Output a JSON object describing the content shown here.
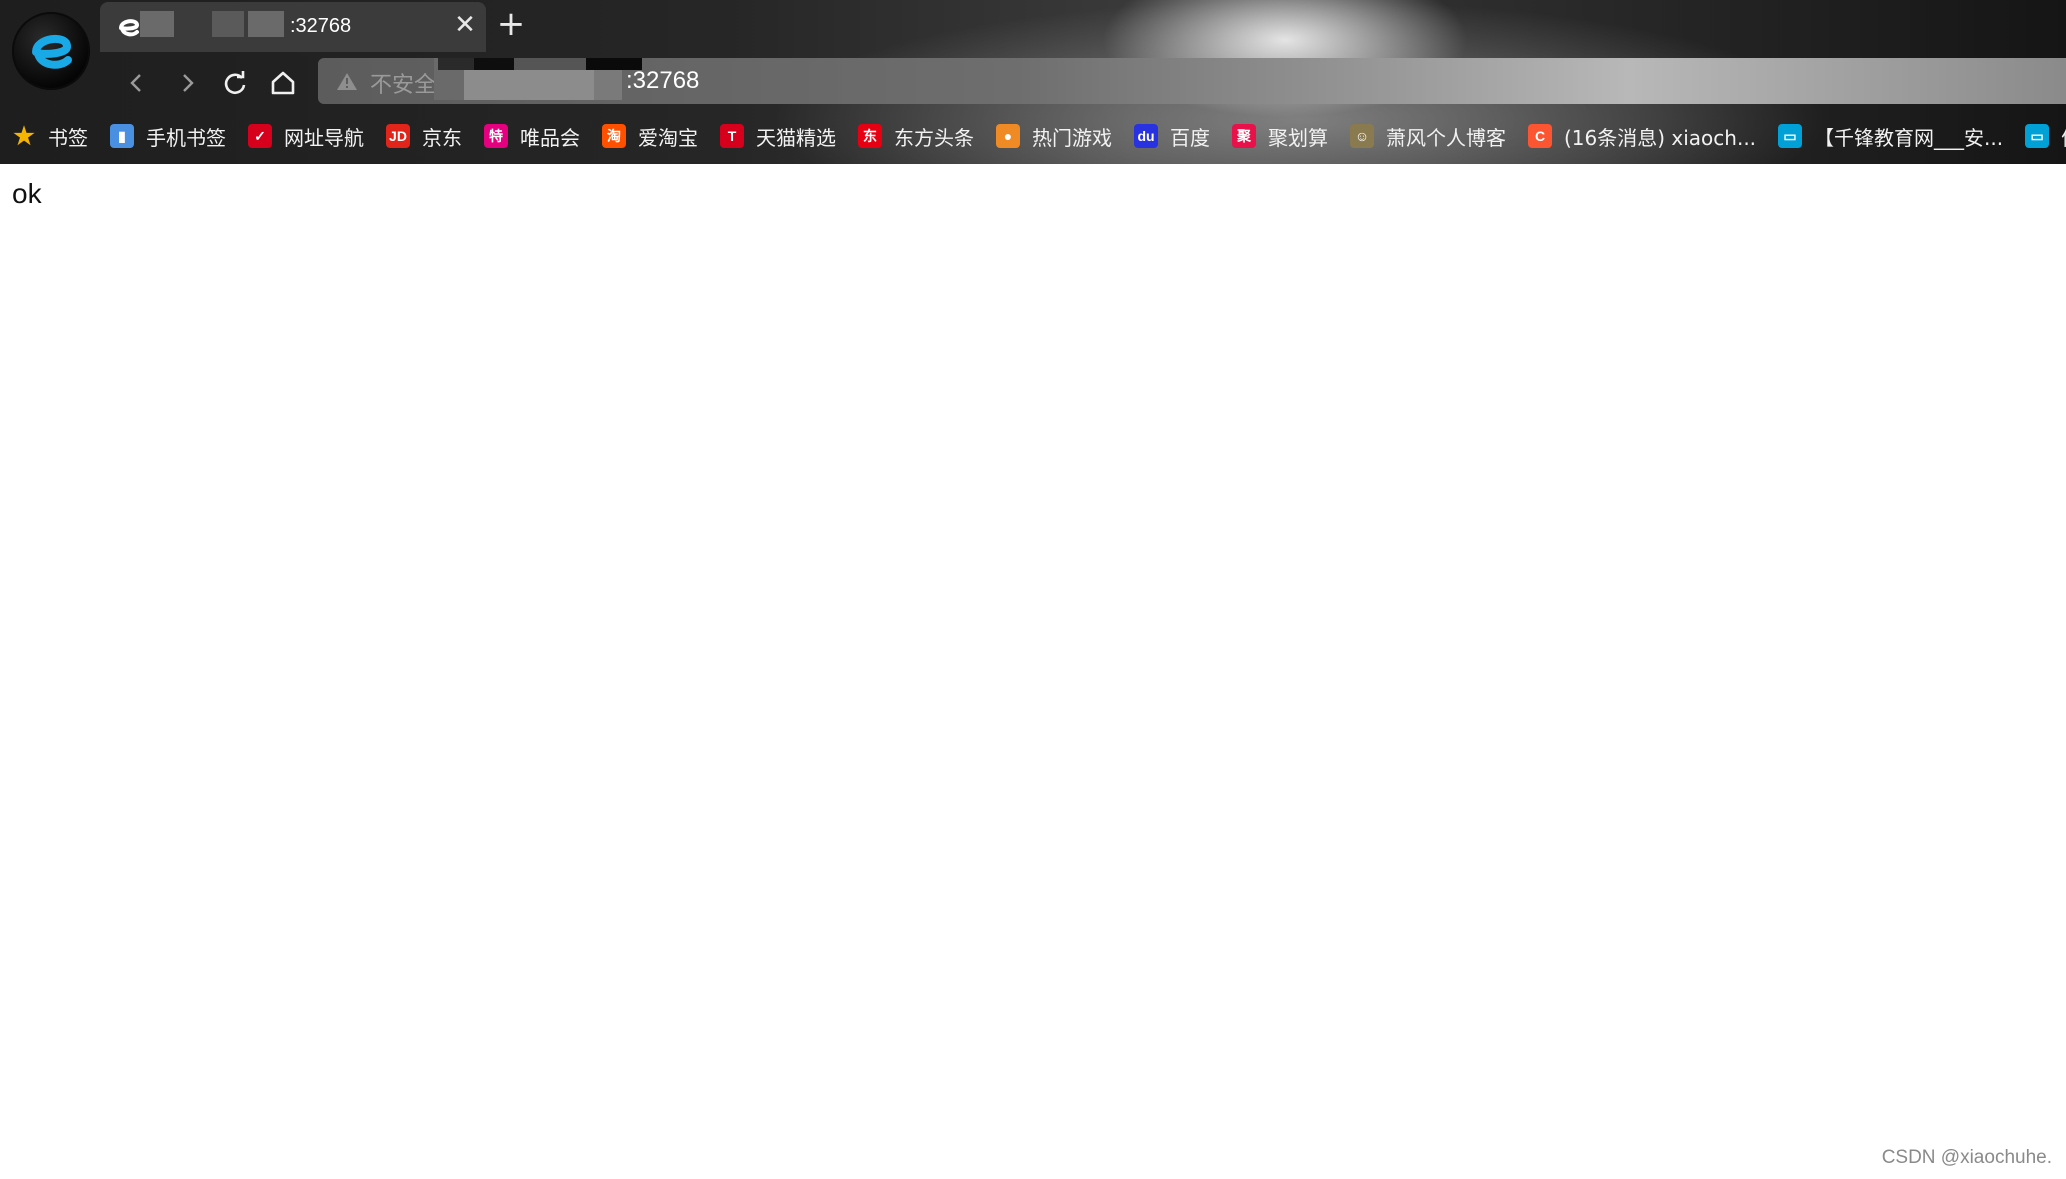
{
  "browser": {
    "tab": {
      "title": ":32768",
      "close_glyph": "✕"
    },
    "new_tab_glyph": "+",
    "address": {
      "security_label": "不安全",
      "url_visible": ":32768"
    }
  },
  "bookmarks": [
    {
      "label": "书签",
      "icon": "star-icon",
      "color": "#f4b400",
      "glyph": "★"
    },
    {
      "label": "手机书签",
      "icon": "phone-bookmark-icon",
      "color": "#4a90e2",
      "glyph": "▮"
    },
    {
      "label": "网址导航",
      "icon": "site-nav-icon",
      "color": "#d6001c",
      "glyph": "✓"
    },
    {
      "label": "京东",
      "icon": "jd-icon",
      "color": "#e1251b",
      "glyph": "JD"
    },
    {
      "label": "唯品会",
      "icon": "vip-icon",
      "color": "#e4007f",
      "glyph": "特"
    },
    {
      "label": "爱淘宝",
      "icon": "taobao-icon",
      "color": "#ff5000",
      "glyph": "淘"
    },
    {
      "label": "天猫精选",
      "icon": "tmall-icon",
      "color": "#d6001c",
      "glyph": "T"
    },
    {
      "label": "东方头条",
      "icon": "dftt-icon",
      "color": "#e60012",
      "glyph": "东"
    },
    {
      "label": "热门游戏",
      "icon": "game-icon",
      "color": "#f08a24",
      "glyph": "●"
    },
    {
      "label": "百度",
      "icon": "baidu-icon",
      "color": "#2932e1",
      "glyph": "du"
    },
    {
      "label": "聚划算",
      "icon": "juhuasuan-icon",
      "color": "#e8114a",
      "glyph": "聚"
    },
    {
      "label": "萧风个人博客",
      "icon": "blog-avatar-icon",
      "color": "#8a7a50",
      "glyph": "☺"
    },
    {
      "label": "(16条消息) xiaoch...",
      "icon": "csdn-icon",
      "color": "#fc5531",
      "glyph": "C"
    },
    {
      "label": "【千锋教育网___安...",
      "icon": "bilibili-icon",
      "color": "#00a1d6",
      "glyph": "▭"
    },
    {
      "label": "信",
      "icon": "bilibili-icon",
      "color": "#00a1d6",
      "glyph": "▭"
    }
  ],
  "page": {
    "body_text": "ok"
  },
  "watermark": "CSDN @xiaochuhe."
}
